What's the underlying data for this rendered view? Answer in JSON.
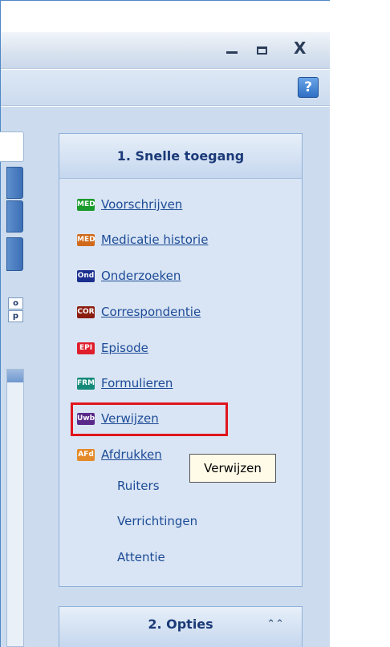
{
  "window": {
    "controls": {
      "minimize": "–",
      "restore": "□",
      "close": "X"
    },
    "help_label": "?"
  },
  "left_strip": {
    "mini_buttons": [
      "o",
      "p"
    ]
  },
  "quick_access": {
    "title": "1. Snelle toegang",
    "items": [
      {
        "badge": "MED",
        "badge_color": "#1a9a2a",
        "label": "Voorschrijven"
      },
      {
        "badge": "MED",
        "badge_color": "#d06a1a",
        "label": "Medicatie historie"
      },
      {
        "badge": "Ond",
        "badge_color": "#1b2f8f",
        "label": "Onderzoeken"
      },
      {
        "badge": "COR",
        "badge_color": "#8a1d10",
        "label": "Correspondentie"
      },
      {
        "badge": "EPI",
        "badge_color": "#e01d2b",
        "label": "Episode"
      },
      {
        "badge": "FRM",
        "badge_color": "#158a7a",
        "label": "Formulieren"
      },
      {
        "badge": "Uwb",
        "badge_color": "#5a2a8a",
        "label": "Verwijzen"
      },
      {
        "badge": "AFd",
        "badge_color": "#e58a2a",
        "label": "Afdrukken"
      }
    ],
    "plain_items": [
      "Ruiters",
      "Verrichtingen",
      "Attentie"
    ],
    "tooltip": "Verwijzen"
  },
  "options": {
    "title": "2. Opties",
    "chevron": "⌃⌃"
  }
}
